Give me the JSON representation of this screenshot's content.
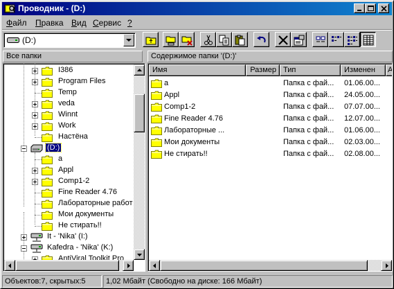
{
  "window": {
    "title": "Проводник - (D:)"
  },
  "menu": [
    {
      "label": "Файл",
      "key": "Ф",
      "rest": "айл"
    },
    {
      "label": "Правка",
      "key": "П",
      "rest": "равка"
    },
    {
      "label": "Вид",
      "key": "В",
      "rest": "ид"
    },
    {
      "label": "Сервис",
      "key": "С",
      "rest": "ервис"
    },
    {
      "label": "?",
      "key": "?",
      "rest": ""
    }
  ],
  "toolbar": {
    "drive_combo_value": "(D:)",
    "buttons": [
      "up-folder",
      "map-network-drive",
      "disconnect-network-drive",
      "cut",
      "copy",
      "paste",
      "undo",
      "delete",
      "properties",
      "large-icons",
      "small-icons",
      "list",
      "details"
    ]
  },
  "left_pane": {
    "header": "Все папки",
    "tree": [
      {
        "label": "I386",
        "expander": "plus",
        "icon": "folder"
      },
      {
        "label": "Program Files",
        "expander": "plus",
        "icon": "folder"
      },
      {
        "label": "Temp",
        "expander": "",
        "icon": "folder"
      },
      {
        "label": "veda",
        "expander": "plus",
        "icon": "folder"
      },
      {
        "label": "Winnt",
        "expander": "plus",
        "icon": "folder"
      },
      {
        "label": "Work",
        "expander": "plus",
        "icon": "folder"
      },
      {
        "label": "Настёна",
        "expander": "",
        "icon": "folder"
      },
      {
        "label": "(D:)",
        "expander": "minus",
        "icon": "drive",
        "selected": true
      },
      {
        "label": "a",
        "expander": "",
        "icon": "folder"
      },
      {
        "label": "Appl",
        "expander": "plus",
        "icon": "folder"
      },
      {
        "label": "Comp1-2",
        "expander": "plus",
        "icon": "folder"
      },
      {
        "label": "Fine Reader 4.76",
        "expander": "",
        "icon": "folder"
      },
      {
        "label": "Лабораторные работ",
        "expander": "",
        "icon": "folder"
      },
      {
        "label": "Мои документы",
        "expander": "",
        "icon": "folder"
      },
      {
        "label": "Не стирать!!",
        "expander": "",
        "icon": "folder"
      },
      {
        "label": "It - 'Nika' (I:)",
        "expander": "plus",
        "icon": "netdrive"
      },
      {
        "label": "Kafedra - 'Nika' (K:)",
        "expander": "minus",
        "icon": "netdrive"
      },
      {
        "label": "AntiViral Toolkit Pro",
        "expander": "plus",
        "icon": "folder"
      }
    ]
  },
  "right_pane": {
    "header": "Содержимое папки '(D:)'",
    "columns": [
      "Имя",
      "Размер",
      "Тип",
      "Изменен",
      "А"
    ],
    "rows": [
      {
        "name": "a",
        "size": "",
        "type": "Папка с фай...",
        "modified": "01.06.00..."
      },
      {
        "name": "Appl",
        "size": "",
        "type": "Папка с фай...",
        "modified": "24.05.00..."
      },
      {
        "name": "Comp1-2",
        "size": "",
        "type": "Папка с фай...",
        "modified": "07.07.00..."
      },
      {
        "name": "Fine Reader 4.76",
        "size": "",
        "type": "Папка с фай...",
        "modified": "12.07.00..."
      },
      {
        "name": "Лабораторные ...",
        "size": "",
        "type": "Папка с фай...",
        "modified": "01.06.00..."
      },
      {
        "name": "Мои документы",
        "size": "",
        "type": "Папка с фай...",
        "modified": "02.03.00..."
      },
      {
        "name": "Не стирать!!",
        "size": "",
        "type": "Папка с фай...",
        "modified": "02.08.00..."
      }
    ]
  },
  "status": {
    "objects": "Объектов:7, скрытых:5",
    "disk": "1,02 Мбайт (Свободно на диске: 166 Мбайт)"
  },
  "colors": {
    "title_bar": "#000080",
    "window_face": "#c0c0c0",
    "selection": "#000080",
    "folder_yellow": "#ffff00"
  }
}
